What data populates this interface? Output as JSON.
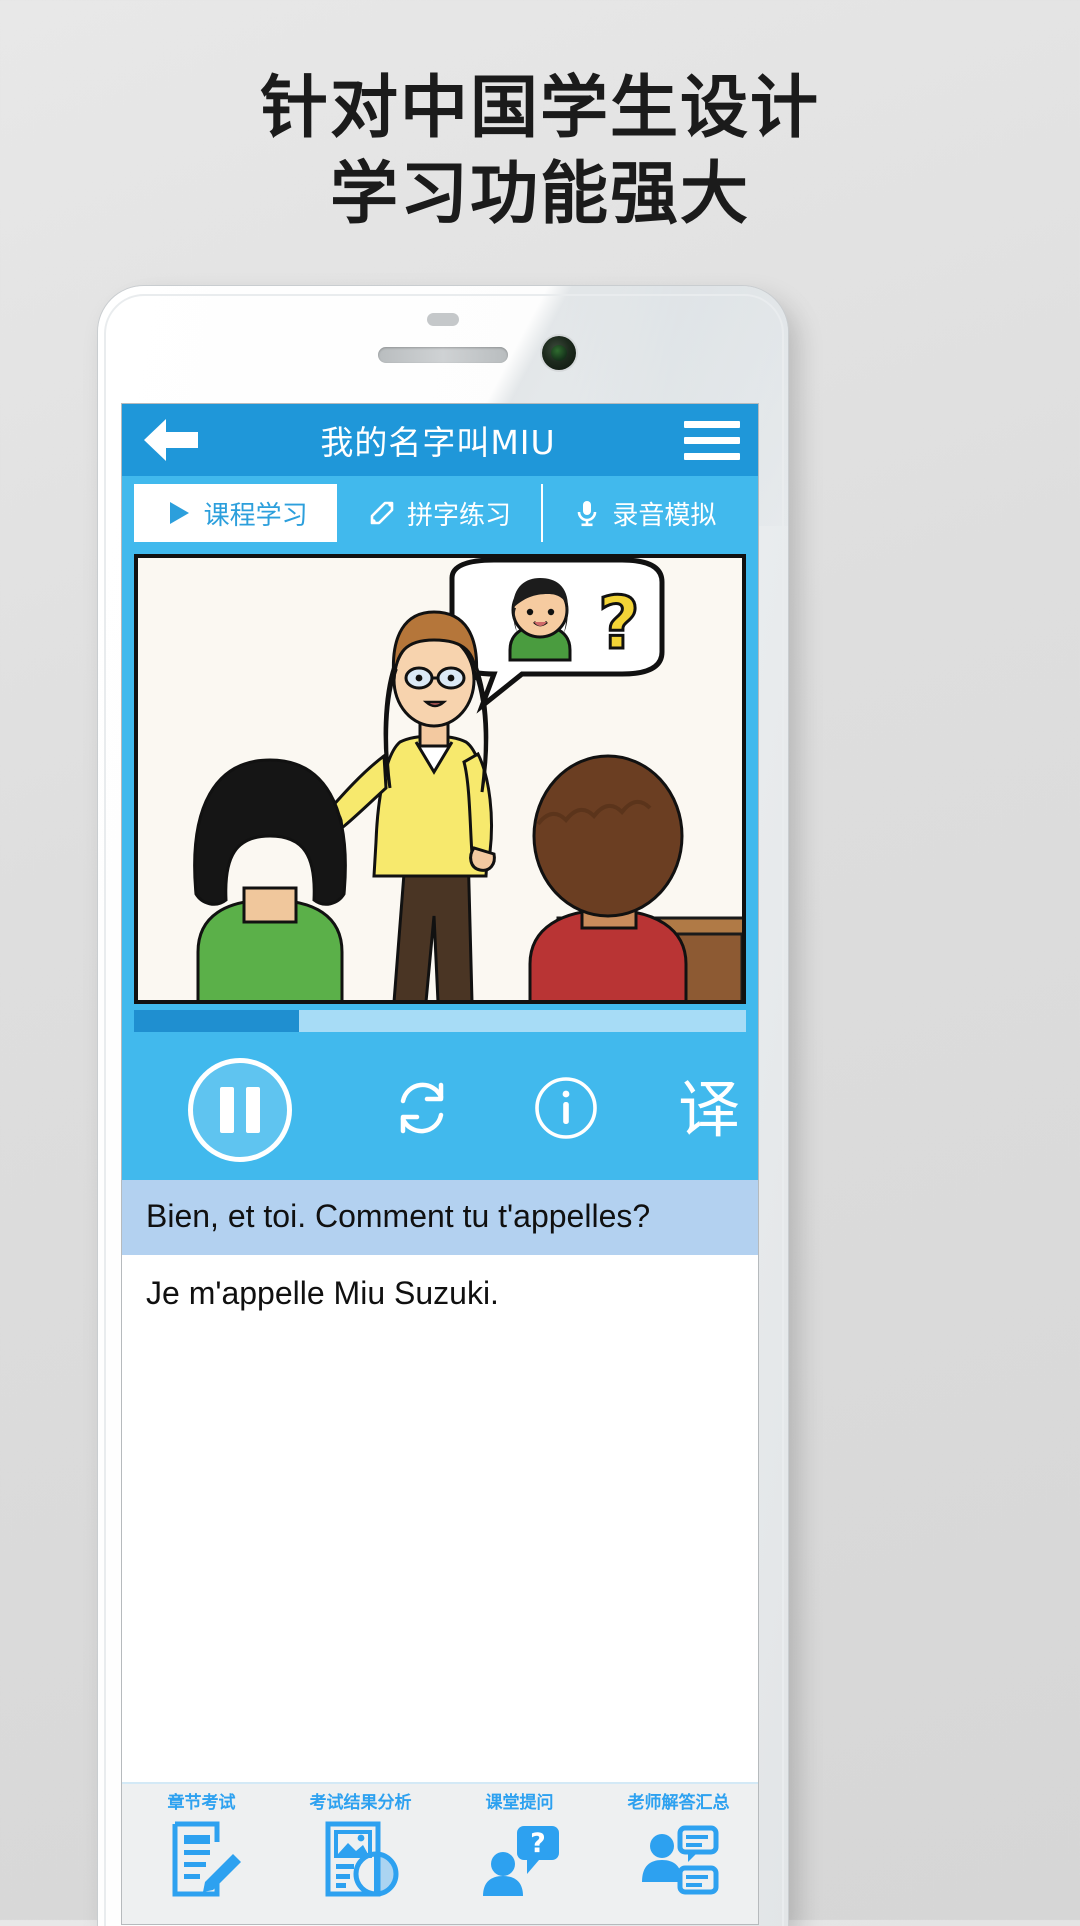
{
  "headline": {
    "line1": "针对中国学生设计",
    "line2": "学习功能强大"
  },
  "app": {
    "appbar": {
      "back_icon": "arrow-left-icon",
      "title": "我的名字叫MIU",
      "menu_icon": "hamburger-menu-icon",
      "bg_color": "#1f97d9"
    },
    "tabs": [
      {
        "label": "课程学习",
        "icon": "play-triangle-icon",
        "active": true
      },
      {
        "label": "拼字练习",
        "icon": "pencil-line-icon",
        "active": false
      },
      {
        "label": "录音模拟",
        "icon": "microphone-icon",
        "active": false
      }
    ],
    "player": {
      "progress_percent": 27,
      "controls": [
        {
          "name": "pause-button",
          "icon": "pause-icon"
        },
        {
          "name": "repeat-button",
          "icon": "repeat-loop-icon"
        },
        {
          "name": "info-button",
          "icon": "info-circle-icon"
        },
        {
          "name": "translate-button",
          "icon": "translate-glyph",
          "glyph": "译"
        }
      ]
    },
    "subtitles": {
      "active_line": "Bien, et toi. Comment tu t'appelles?",
      "next_line": "Je m'appelle Miu Suzuki."
    },
    "bottombar": [
      {
        "label": "章节考试",
        "icon": "document-pencil-icon"
      },
      {
        "label": "考试结果分析",
        "icon": "report-chart-icon"
      },
      {
        "label": "课堂提问",
        "icon": "person-question-icon"
      },
      {
        "label": "老师解答汇总",
        "icon": "teacher-answers-icon"
      }
    ],
    "accent_colors": {
      "appbar": "#1f97d9",
      "tabs": "#41b9ed",
      "tab_active_text": "#2c9fdc",
      "progress_fill": "#1f8fd0",
      "progress_track": "#a7dcf6",
      "subtitle_highlight": "#b3d1f0",
      "bottom_icon": "#2da1f0"
    }
  }
}
